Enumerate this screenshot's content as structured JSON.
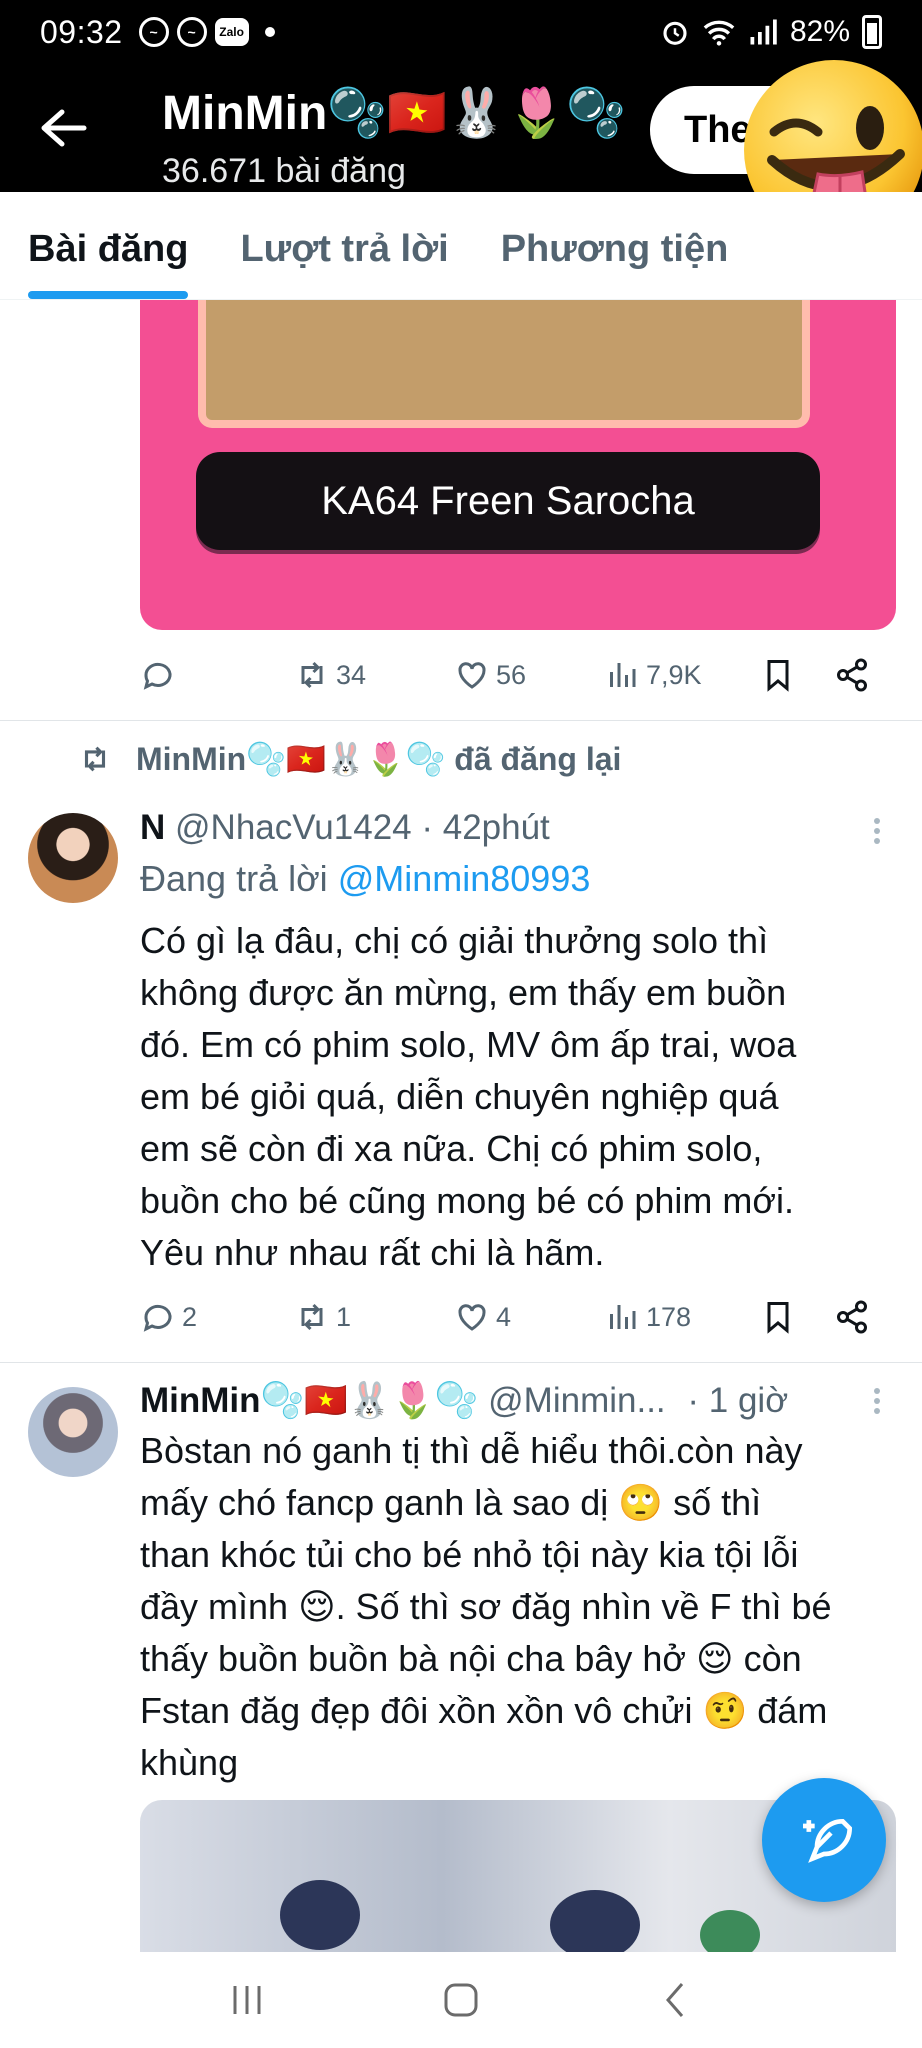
{
  "status_bar": {
    "time": "09:32",
    "battery": "82%"
  },
  "header": {
    "name": "MinMin🫧🇻🇳🐰🌷🫧",
    "post_count": "36.671 bài đăng",
    "follow_label": "The"
  },
  "tabs": [
    {
      "label": "Bài đăng",
      "active": true
    },
    {
      "label": "Lượt trả lời",
      "active": false
    },
    {
      "label": "Phương tiện",
      "active": false
    }
  ],
  "top_media": {
    "label": "KA64 Freen Sarocha"
  },
  "top_actions": {
    "reply": "",
    "repost": "34",
    "like": "56",
    "views": "7,9K"
  },
  "tweet1": {
    "repost_by": "MinMin🫧🇻🇳🐰🌷🫧 đã đăng lại",
    "name": "N",
    "meta": "@NhacVu1424 · 42phút",
    "reply_prefix": "Đang trả lời",
    "reply_to": "@Minmin80993",
    "body": "Có gì lạ đâu, chị có giải thưởng solo thì\nkhông được ăn mừng, em thấy em buồn\nđó. Em có phim solo, MV ôm ấp trai, woa\nem bé giỏi quá, diễn chuyên nghiệp quá\nem sẽ còn đi xa nữa. Chị có phim solo,\nbuồn cho bé cũng mong bé có phim mới.\nYêu như nhau rất chi là hãm.",
    "actions": {
      "reply": "2",
      "repost": "1",
      "like": "4",
      "views": "178"
    }
  },
  "tweet2": {
    "name": "MinMin🫧🇻🇳🐰🌷🫧",
    "handle": "@Minmin...",
    "time": "· 1 giờ",
    "body": "Bòstan nó ganh tị thì dễ hiểu thôi.còn này\nmấy chó fancp ganh là sao dị 🙄 số thì\nthan khóc tủi cho bé nhỏ tội này kia tội lỗi\nđầy mình 😌. Số thì sơ đăg nhìn về F thì bé\nthấy buồn buồn bà nội cha bây hở 😌 còn\nFstan đăg đẹp đôi xồn xồn vô chửi 🤨 đám\nkhùng"
  },
  "icons": {
    "back": "arrow-left-icon",
    "reply": "chat-bubble-icon",
    "repost": "repost-icon",
    "like": "heart-icon",
    "views": "bar-chart-icon",
    "bookmark": "bookmark-icon",
    "share": "share-icon",
    "compose": "feather-plus-icon"
  },
  "colors": {
    "accent": "#1d9bf0",
    "text": "#0f1419",
    "muted": "#536471",
    "media_pink": "#f34f93"
  }
}
